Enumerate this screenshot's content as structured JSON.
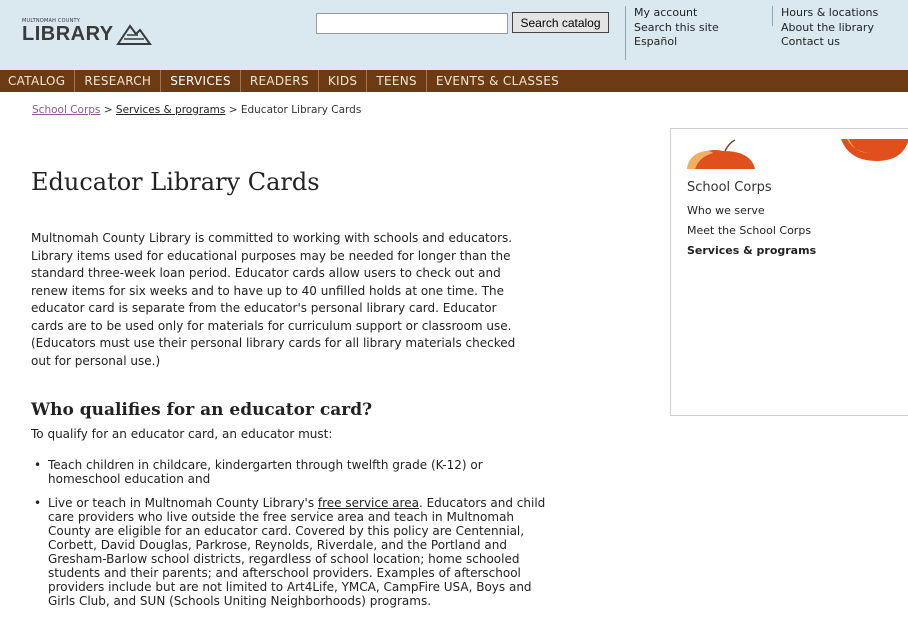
{
  "header": {
    "logo_small": "MULTNOMAH COUNTY",
    "logo_big": "LIBRARY",
    "search_placeholder": "",
    "search_value": "",
    "search_button": "Search catalog",
    "util_col1": [
      "My account",
      "Search this site",
      "Español"
    ],
    "util_col2": [
      "Hours & locations",
      "About the library",
      "Contact us"
    ]
  },
  "nav": {
    "items": [
      "CATALOG",
      "RESEARCH",
      "SERVICES",
      "READERS",
      "KIDS",
      "TEENS",
      "EVENTS & CLASSES"
    ],
    "active": "SERVICES"
  },
  "breadcrumb": {
    "items": [
      "School Corps",
      "Services & programs"
    ],
    "separator": ">",
    "current": "Educator Library Cards"
  },
  "main": {
    "title": "Educator Library Cards",
    "intro_lines": [
      "Multnomah County Library is committed to working with schools and educators.",
      "Library items used for educational purposes may be needed for longer than the",
      "standard three-week loan period. Educator cards allow users to check out and",
      "renew items for six weeks and to have up to 40 unfilled holds at one time. The",
      "educator card is separate from the educator's personal library card. Educator",
      "cards are to be used only for materials for curriculum support or classroom use.",
      "(Educators must use their personal library cards for all library materials checked",
      "out for personal use.)"
    ],
    "section_heading": "Who qualifies for an educator card?",
    "qualify_text": "To qualify for an educator card, an educator must:",
    "bullet_marker": "•",
    "bullet1_lines": [
      "Teach children in childcare, kindergarten through twelfth grade (K-12) or",
      "homeschool education and"
    ],
    "bullet2_first_pre": "Live or teach in Multnomah County Library's ",
    "bullet2_link": "free service area",
    "bullet2_first_post": ". Educators and child",
    "bullet2_lines": [
      "care providers who live outside the free service area and teach in Multnomah",
      "County are eligible for an educator card. Covered by this policy are Centennial,",
      "Corbett, David Douglas, Parkrose, Reynolds, Riverdale, and the Portland and",
      "Gresham-Barlow school districts, regardless of school location; home schooled",
      "students and their parents; and afterschool providers. Examples of afterschool",
      "providers include but are not limited to Art4Life, YMCA, CampFire USA, Boys and",
      "Girls Club, and SUN (Schools Uniting Neighborhoods) programs."
    ]
  },
  "sidebar": {
    "title": "School Corps",
    "links": [
      "Who we serve",
      "Meet the School Corps",
      "Services & programs"
    ],
    "current": "Services & programs"
  },
  "colors": {
    "header_bg": "#d9e9ef",
    "nav_bg": "#6c3b14",
    "apple_red": "#e0501c",
    "apple_yellow": "#f0b060"
  }
}
